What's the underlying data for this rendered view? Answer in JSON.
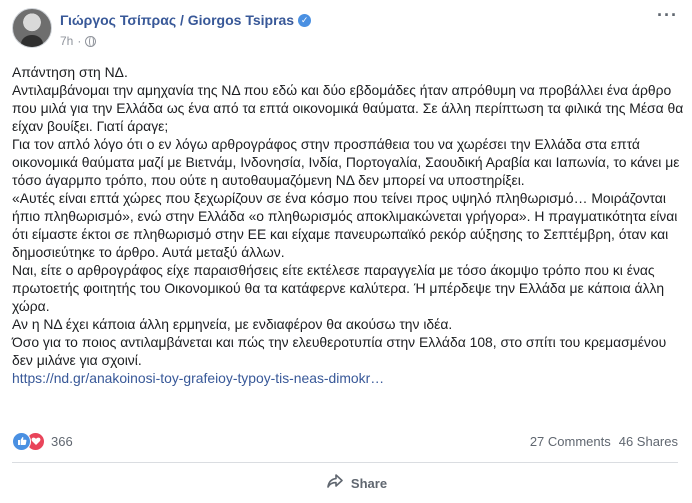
{
  "post": {
    "author": "Γιώργος Τσίπρας / Giorgos Tsipras",
    "time": "7h",
    "dot": "·",
    "paragraphs": [
      "Απάντηση στη ΝΔ.",
      "Αντιλαμβάνομαι την αμηχανία της ΝΔ που εδώ και δύο εβδομάδες ήταν απρόθυμη να προβάλλει ένα άρθρο που μιλά για την Ελλάδα ως ένα από τα επτά οικονομικά θαύματα. Σε άλλη περίπτωση τα φιλικά της Μέσα θα είχαν βουίξει. Γιατί άραγε;",
      "Για τον απλό λόγο ότι ο εν λόγω αρθρογράφος στην προσπάθεια του να χωρέσει την Ελλάδα στα επτά οικονομικά θαύματα μαζί με Βιετνάμ, Ινδονησία, Ινδία, Πορτογαλία, Σαουδική Αραβία και Ιαπωνία, το κάνει με τόσο άγαρμπο τρόπο, που ούτε η αυτοθαυμαζόμενη ΝΔ δεν μπορεί να υποστηρίξει.",
      "«Αυτές είναι επτά χώρες που ξεχωρίζουν σε ένα κόσμο που τείνει προς υψηλό πληθωρισμό… Μοιράζονται ήπιο πληθωρισμό», ενώ στην Ελλάδα «ο πληθωρισμός αποκλιμακώνεται γρήγορα». Η πραγματικότητα είναι ότι είμαστε έκτοι σε πληθωρισμό στην ΕΕ και είχαμε πανευρωπαϊκό ρεκόρ αύξησης το Σεπτέμβρη, όταν και δημοσιεύτηκε το άρθρο. Αυτά μεταξύ άλλων.",
      "Ναι, είτε ο αρθρογράφος είχε παραισθήσεις είτε εκτέλεσε παραγγελία με τόσο άκομψο τρόπο που κι ένας πρωτοετής φοιτητής του Οικονομικού θα τα κατάφερνε καλύτερα. Ή μπέρδεψε την Ελλάδα με κάποια άλλη χώρα.",
      "Αν η ΝΔ έχει κάποια άλλη ερμηνεία, με ενδιαφέρον θα ακούσω την ιδέα.",
      "Όσο για το ποιος αντιλαμβάνεται και πώς την ελευθεροτυπία στην Ελλάδα 108, στο σπίτι του κρεμασμένου δεν μιλάνε για σχοινί."
    ],
    "link": "https://nd.gr/anakoinosi-toy-grafeioy-typoy-tis-neas-dimokr…"
  },
  "stats": {
    "reactions": "366",
    "comments": "27 Comments",
    "shares": "46 Shares"
  },
  "actions": {
    "share_label": "Share"
  },
  "icons": {
    "verified": "verified-badge-icon",
    "globe": "globe-icon",
    "like": "like-reaction-icon",
    "love": "love-reaction-icon",
    "share": "share-arrow-icon",
    "more": "more-options-icon"
  },
  "colors": {
    "name": "#385898",
    "link": "#385898",
    "like": "#4a90e2",
    "love": "#e9445a",
    "muted": "#606770"
  }
}
